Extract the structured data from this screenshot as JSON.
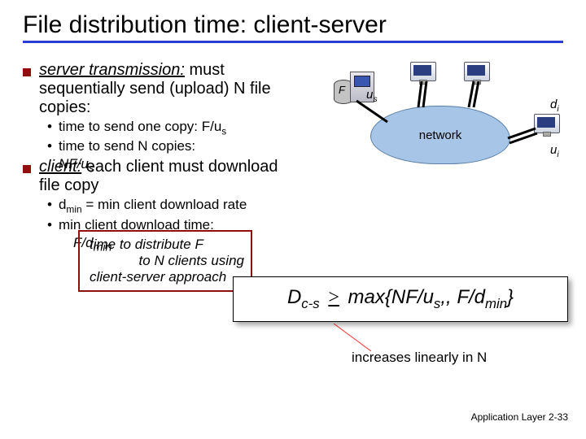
{
  "title": "File distribution time: client-server",
  "bullets": {
    "b1_prefix": "server transmission:",
    "b1_rest": " must sequentially send (upload) N file copies:",
    "b1s1": "time to send one copy: F/u",
    "b1s1_sub": "s",
    "b1s2": "time to send N copies:",
    "nfus": "NF/u",
    "nfus_sub": "s",
    "b2_prefix": "client:",
    "b2_rest": " each client must download file copy",
    "b2s1_a": "d",
    "b2s1_sub": "min",
    "b2s1_b": " = min client download rate",
    "b2s2": "min client download time:",
    "fdmin": "F/d",
    "fdmin_sub": "min"
  },
  "boxed": {
    "l1": "time to  distribute F",
    "l2": "to N clients using",
    "l3": "client-server approach"
  },
  "formula": {
    "lhs": "D",
    "lhs_sub": "c-s",
    "ge": ">",
    "rhs": " max{NF/u",
    "rhs_sub1": "s",
    "rhs_mid": ",, F/d",
    "rhs_sub2": "min",
    "rhs_end": "}"
  },
  "annotation": "increases linearly in N",
  "diagram": {
    "network_label": "network",
    "F": "F",
    "us": "u",
    "us_sub": "s",
    "di": "d",
    "di_sub": "i",
    "ui": "u",
    "ui_sub": "i"
  },
  "footer_left": "Application Layer",
  "footer_right": " 2-33"
}
